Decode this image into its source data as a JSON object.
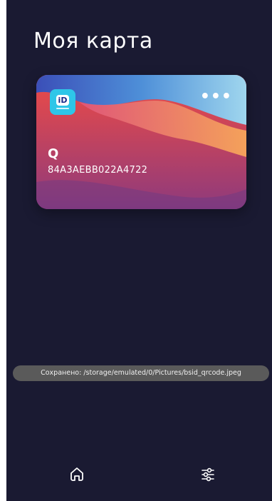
{
  "page": {
    "title": "Моя карта"
  },
  "card": {
    "logo_text": "iD",
    "more_label": "•••",
    "name": "Q",
    "id": "84A3AEBB022A4722"
  },
  "toast": {
    "message": "Сохранено: /storage/emulated/0/Pictures/bsid_qrcode.jpeg"
  },
  "bottom_nav": {
    "items": [
      {
        "icon": "home-icon"
      },
      {
        "icon": "sliders-icon"
      }
    ]
  },
  "colors": {
    "background": "#1a1a32",
    "logo": "#2ec6e8",
    "toast": "#5a5a5a"
  }
}
